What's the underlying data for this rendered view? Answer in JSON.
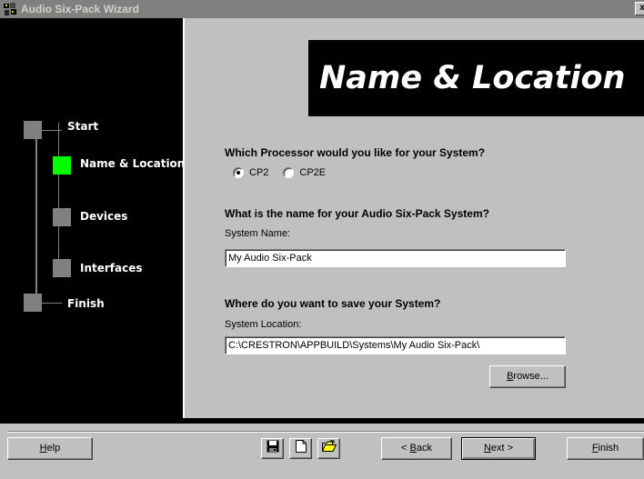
{
  "window": {
    "title": "Audio Six-Pack Wizard",
    "close_label": "x"
  },
  "steps": [
    {
      "label": "Start",
      "active": false
    },
    {
      "label": "Name & Location",
      "active": true
    },
    {
      "label": "Devices",
      "active": false
    },
    {
      "label": "Interfaces",
      "active": false
    },
    {
      "label": "Finish",
      "active": false
    }
  ],
  "page": {
    "heading": "Name & Location",
    "processor_question": "Which Processor would you like for your System?",
    "processor_options": [
      {
        "label": "CP2",
        "checked": true
      },
      {
        "label": "CP2E",
        "checked": false
      }
    ],
    "name_question": "What is the name for your Audio Six-Pack System?",
    "name_label": "System Name:",
    "name_value": "My Audio Six-Pack",
    "location_question": "Where do you want to save your System?",
    "location_label": "System Location:",
    "location_value": "C:\\CRESTRON\\APPBUILD\\Systems\\My Audio Six-Pack\\",
    "browse_prefix": "",
    "browse_accel": "B",
    "browse_rest": "rowse..."
  },
  "footer": {
    "help_accel": "H",
    "help_rest": "elp",
    "back_prefix": "< ",
    "back_accel": "B",
    "back_rest": "ack",
    "next_accel": "N",
    "next_rest": "ext >",
    "finish_accel": "F",
    "finish_rest": "inish",
    "icons": [
      "save-icon",
      "new-document-icon",
      "open-folder-icon"
    ]
  },
  "colors": {
    "active_step": "#00ff00",
    "sidebar_bg": "#000000",
    "face": "#c0c0c0"
  }
}
